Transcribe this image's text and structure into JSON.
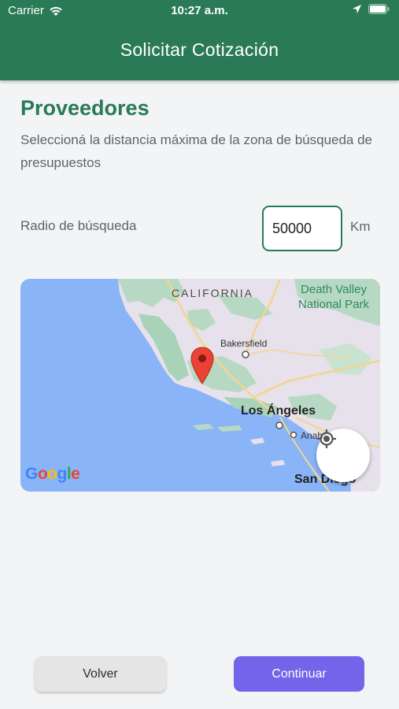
{
  "status_bar": {
    "carrier": "Carrier",
    "time": "10:27 a.m."
  },
  "header": {
    "title": "Solicitar Cotización",
    "background_color": "#2a7a55"
  },
  "section": {
    "title": "Proveedores",
    "description": "Seleccioná la distancia máxima de la zona de búsqueda de presupuestos"
  },
  "radius": {
    "label": "Radio de búsqueda",
    "value": "50000",
    "unit": "Km"
  },
  "map": {
    "labels": {
      "california": "CALIFORNIA",
      "death_valley": "Death Valley National Park",
      "bakersfield": "Bakersfield",
      "los_angeles": "Los Ángeles",
      "anaheim": "Anah",
      "san_diego": "San Diego"
    },
    "attribution": "Google",
    "marker_icon": "map-pin-icon",
    "locate_icon": "my-location-icon"
  },
  "buttons": {
    "back": "Volver",
    "continue": "Continuar"
  },
  "colors": {
    "accent": "#2a7a55",
    "primary_button": "#7265ea",
    "secondary_button": "#e5e5e5"
  }
}
